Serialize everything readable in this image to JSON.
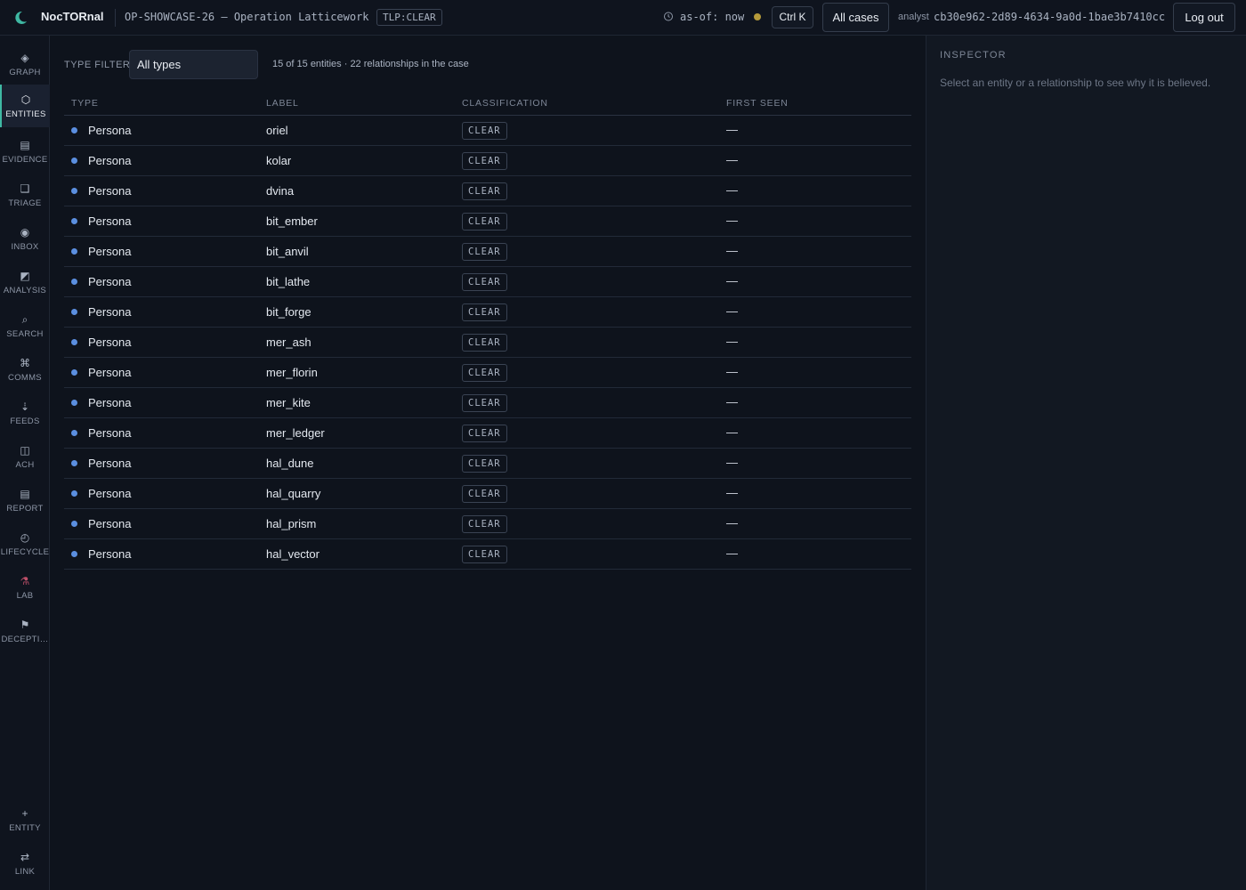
{
  "header": {
    "brand": "NocTORnal",
    "case_title": "OP-SHOWCASE-26 — Operation Latticework",
    "tlp": "TLP:CLEAR",
    "asof": "as-of: now",
    "shortcut": "Ctrl K",
    "all_cases": "All cases",
    "analyst_label": "analyst",
    "analyst_id": "cb30e962-2d89-4634-9a0d-1bae3b7410cc",
    "logout": "Log out"
  },
  "sidebar": {
    "items": [
      {
        "label": "GRAPH",
        "icon": "◈"
      },
      {
        "label": "ENTITIES",
        "icon": "⬡"
      },
      {
        "label": "EVIDENCE",
        "icon": "▤"
      },
      {
        "label": "TRIAGE",
        "icon": "❑"
      },
      {
        "label": "INBOX",
        "icon": "◉"
      },
      {
        "label": "ANALYSIS",
        "icon": "◩"
      },
      {
        "label": "SEARCH",
        "icon": "⌕"
      },
      {
        "label": "COMMS",
        "icon": "⌘"
      },
      {
        "label": "FEEDS",
        "icon": "⇣"
      },
      {
        "label": "ACH",
        "icon": "◫"
      },
      {
        "label": "REPORT",
        "icon": "▤"
      },
      {
        "label": "LIFECYCLE",
        "icon": "◴"
      },
      {
        "label": "LAB",
        "icon": "⚗"
      },
      {
        "label": "DECEPTI…",
        "icon": "⚑"
      }
    ],
    "bottom": [
      {
        "label": "ENTITY",
        "icon": "+"
      },
      {
        "label": "LINK",
        "icon": "⇄"
      }
    ]
  },
  "filter": {
    "label": "TYPE FILTER",
    "selected": "All types",
    "summary": "15 of 15 entities · 22 relationships in the case"
  },
  "table": {
    "columns": [
      "TYPE",
      "LABEL",
      "CLASSIFICATION",
      "FIRST SEEN"
    ],
    "rows": [
      {
        "type": "Persona",
        "label": "oriel",
        "classification": "CLEAR",
        "first_seen": "—"
      },
      {
        "type": "Persona",
        "label": "kolar",
        "classification": "CLEAR",
        "first_seen": "—"
      },
      {
        "type": "Persona",
        "label": "dvina",
        "classification": "CLEAR",
        "first_seen": "—"
      },
      {
        "type": "Persona",
        "label": "bit_ember",
        "classification": "CLEAR",
        "first_seen": "—"
      },
      {
        "type": "Persona",
        "label": "bit_anvil",
        "classification": "CLEAR",
        "first_seen": "—"
      },
      {
        "type": "Persona",
        "label": "bit_lathe",
        "classification": "CLEAR",
        "first_seen": "—"
      },
      {
        "type": "Persona",
        "label": "bit_forge",
        "classification": "CLEAR",
        "first_seen": "—"
      },
      {
        "type": "Persona",
        "label": "mer_ash",
        "classification": "CLEAR",
        "first_seen": "—"
      },
      {
        "type": "Persona",
        "label": "mer_florin",
        "classification": "CLEAR",
        "first_seen": "—"
      },
      {
        "type": "Persona",
        "label": "mer_kite",
        "classification": "CLEAR",
        "first_seen": "—"
      },
      {
        "type": "Persona",
        "label": "mer_ledger",
        "classification": "CLEAR",
        "first_seen": "—"
      },
      {
        "type": "Persona",
        "label": "hal_dune",
        "classification": "CLEAR",
        "first_seen": "—"
      },
      {
        "type": "Persona",
        "label": "hal_quarry",
        "classification": "CLEAR",
        "first_seen": "—"
      },
      {
        "type": "Persona",
        "label": "hal_prism",
        "classification": "CLEAR",
        "first_seen": "—"
      },
      {
        "type": "Persona",
        "label": "hal_vector",
        "classification": "CLEAR",
        "first_seen": "—"
      }
    ]
  },
  "inspector": {
    "title": "INSPECTOR",
    "hint": "Select an entity or a relationship to see why it is believed."
  }
}
